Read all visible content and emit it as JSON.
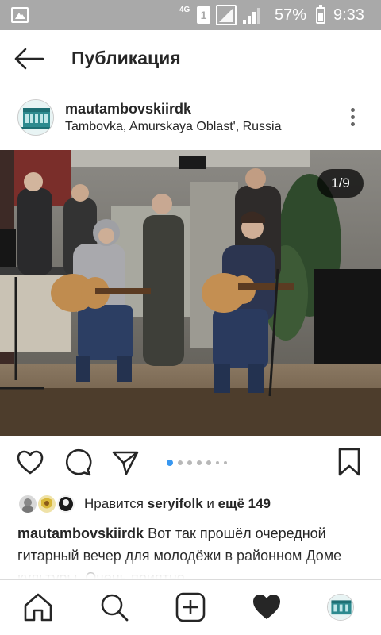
{
  "status_bar": {
    "network": "4G",
    "sim": "1",
    "battery_percent": "57%",
    "time": "9:33"
  },
  "header": {
    "title": "Публикация"
  },
  "post": {
    "username": "mautambovskiirdk",
    "location": "Tambovka, Amurskaya Oblast', Russia",
    "image_counter": "1/9",
    "carousel": {
      "current": 1,
      "total": 9
    },
    "likes": {
      "prefix": "Нравится",
      "user": "seryifolk",
      "conjunction": "и",
      "others": "ещё 149"
    },
    "caption": {
      "username": "mautambovskiirdk",
      "text": "Вот так прошёл очередной гитарный вечер для молодёжи в районном Доме культуры. Очень приятно"
    }
  },
  "icons": {
    "back": "arrow-left-icon",
    "more": "more-vertical-icon",
    "like": "heart-outline-icon",
    "comment": "comment-icon",
    "share": "send-icon",
    "save": "bookmark-icon",
    "nav": [
      "home-icon",
      "search-icon",
      "add-post-icon",
      "activity-heart-icon",
      "profile-icon"
    ]
  },
  "colors": {
    "accent_dot": "#3897f0",
    "text": "#262626",
    "status_bar": "#a9a9a9"
  }
}
